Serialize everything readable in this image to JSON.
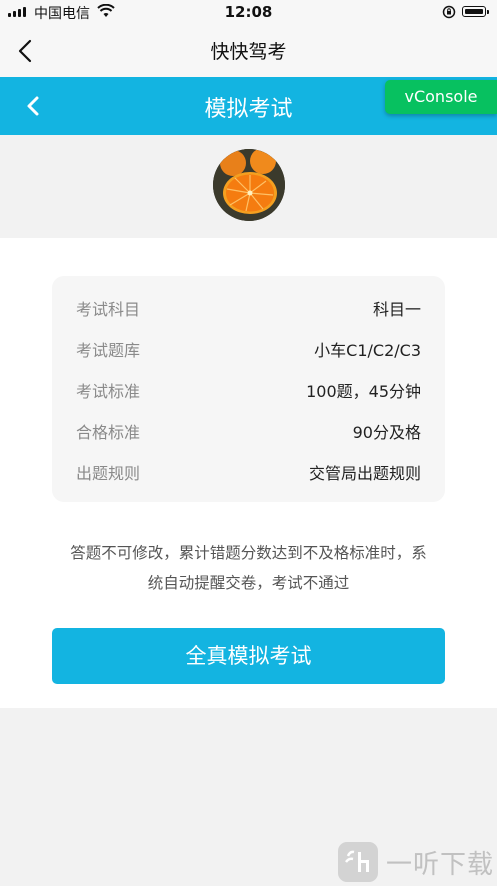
{
  "status_bar": {
    "carrier": "中国电信",
    "time": "12:08",
    "icons": [
      "signal-icon",
      "wifi-icon",
      "rotation-lock-icon",
      "battery-icon"
    ]
  },
  "app_header": {
    "title": "快快驾考",
    "back_icon": "chevron-left-icon"
  },
  "page_header": {
    "title": "模拟考试",
    "back_icon": "chevron-left-icon",
    "color": "#13b4e1"
  },
  "vconsole": {
    "label": "vConsole",
    "color": "#07c160"
  },
  "exam_info": [
    {
      "label": "考试科目",
      "value": "科目一"
    },
    {
      "label": "考试题库",
      "value": "小车C1/C2/C3"
    },
    {
      "label": "考试标准",
      "value": "100题，45分钟"
    },
    {
      "label": "合格标准",
      "value": "90分及格"
    },
    {
      "label": "出题规则",
      "value": "交管局出题规则"
    }
  ],
  "notice": {
    "line1": "答题不可修改，累计错题分数达到不及格标准时，系",
    "line2": "统自动提醒交卷，考试不通过"
  },
  "start_button": {
    "label": "全真模拟考试"
  },
  "watermark": {
    "text": "一听下载"
  }
}
